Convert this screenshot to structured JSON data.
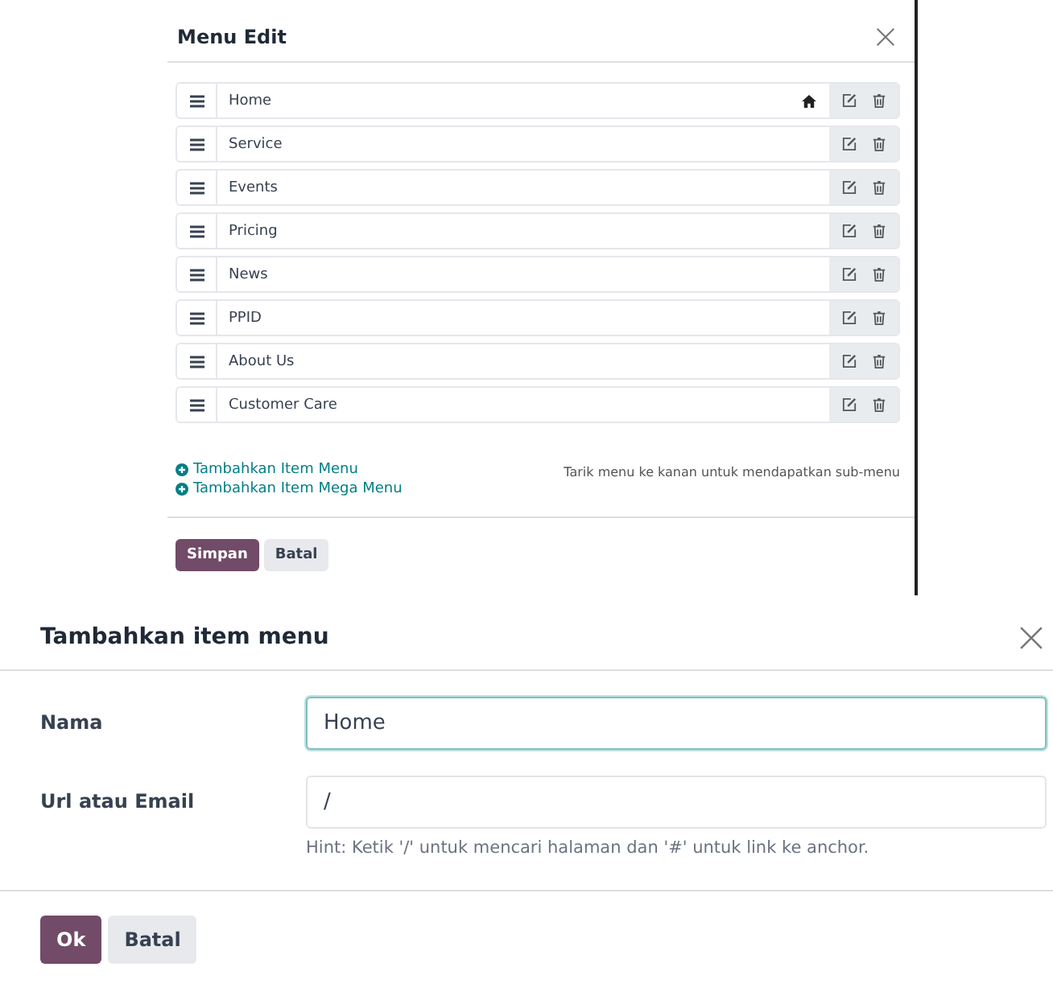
{
  "menu_edit": {
    "title": "Menu Edit",
    "items": [
      {
        "label": "Home",
        "homepage": true
      },
      {
        "label": "Service",
        "homepage": false
      },
      {
        "label": "Events",
        "homepage": false
      },
      {
        "label": "Pricing",
        "homepage": false
      },
      {
        "label": "News",
        "homepage": false
      },
      {
        "label": "PPID",
        "homepage": false
      },
      {
        "label": "About Us",
        "homepage": false
      },
      {
        "label": "Customer Care",
        "homepage": false
      }
    ],
    "links": [
      "Tambahkan Item Menu",
      "Tambahkan Item Mega Menu"
    ],
    "hint": "Tarik menu ke kanan untuk mendapatkan sub-menu",
    "buttons": [
      {
        "label": "Simpan",
        "kind": "primary"
      },
      {
        "label": "Batal",
        "kind": "secondary"
      }
    ]
  },
  "add_item": {
    "title": "Tambahkan item menu",
    "fields": [
      {
        "label": "Nama",
        "value": "Home",
        "focused": true
      },
      {
        "label": "Url atau Email",
        "value": "/",
        "focused": false,
        "hint": "Hint: Ketik '/' untuk mencari halaman dan '#' untuk link ke anchor."
      }
    ],
    "buttons": [
      {
        "label": "Ok",
        "kind": "primary"
      },
      {
        "label": "Batal",
        "kind": "secondary"
      }
    ]
  }
}
